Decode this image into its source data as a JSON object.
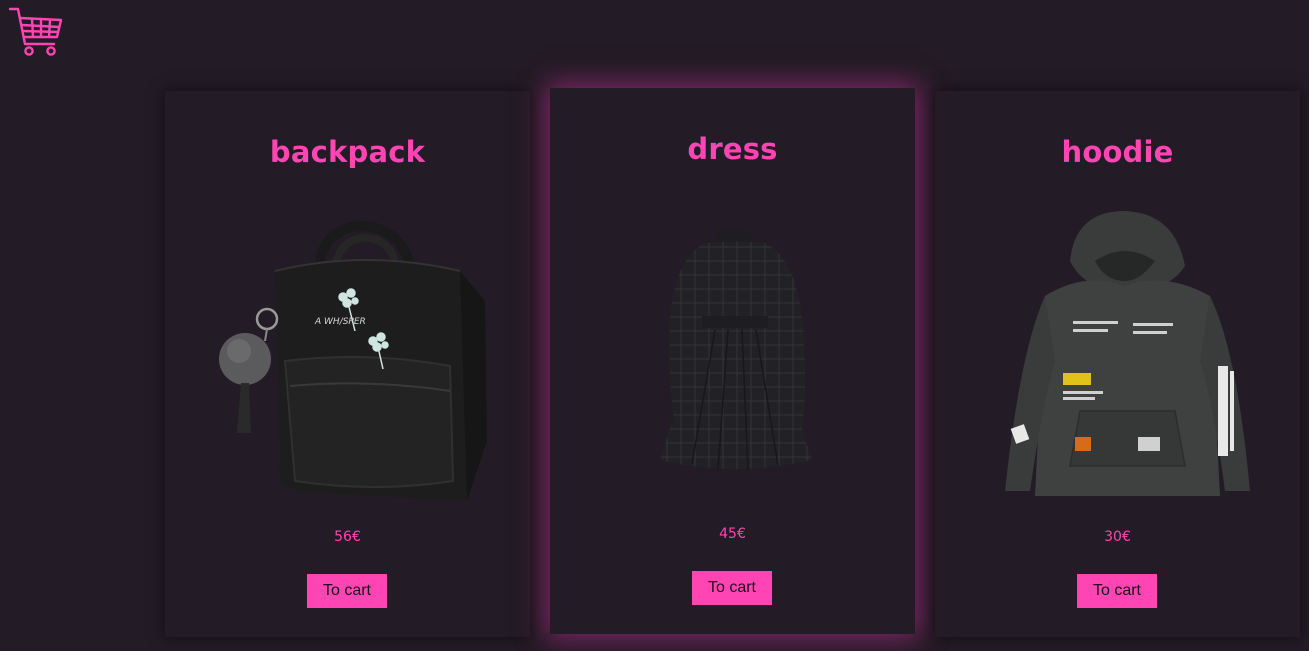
{
  "header": {
    "cart_icon": "shopping-cart-icon"
  },
  "colors": {
    "background": "#231b25",
    "accent": "#ff44b4",
    "card_glow": "#d232a0"
  },
  "products": [
    {
      "name": "backpack",
      "price": "56€",
      "button_label": "To cart",
      "image": "black-backpack-image"
    },
    {
      "name": "dress",
      "price": "45€",
      "button_label": "To cart",
      "image": "black-plaid-dress-image"
    },
    {
      "name": "hoodie",
      "price": "30€",
      "button_label": "To cart",
      "image": "black-hoodie-image"
    }
  ]
}
